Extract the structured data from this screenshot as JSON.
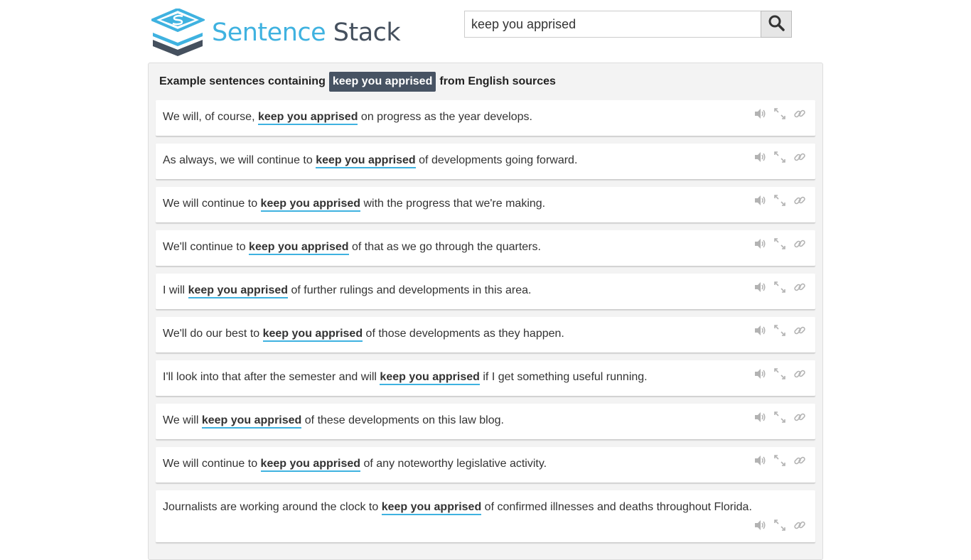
{
  "site": {
    "brand_word_1": "Sentence",
    "brand_word_2": "Stack"
  },
  "search": {
    "value": "keep you apprised",
    "placeholder": ""
  },
  "header": {
    "prefix": "Example sentences containing",
    "term": "keep you apprised",
    "suffix": "from English sources"
  },
  "icons": [
    "speaker-icon",
    "expand-icon",
    "link-icon",
    "search-icon"
  ],
  "colors": {
    "accent": "#3fb2e0",
    "dark": "#475363",
    "panel_bg": "#f3f3f3"
  },
  "sentences": [
    {
      "before": "We will, of course, ",
      "phrase": "keep you apprised",
      "after": " on progress as the year develops."
    },
    {
      "before": "As always, we will continue to ",
      "phrase": "keep you apprised",
      "after": " of developments going forward."
    },
    {
      "before": "We will continue to ",
      "phrase": "keep you apprised",
      "after": " with the progress that we're making."
    },
    {
      "before": "We'll continue to ",
      "phrase": "keep you apprised",
      "after": " of that as we go through the quarters."
    },
    {
      "before": "I will ",
      "phrase": "keep you apprised",
      "after": " of further rulings and developments in this area."
    },
    {
      "before": "We'll do our best to ",
      "phrase": "keep you apprised",
      "after": " of those developments as they happen."
    },
    {
      "before": "I'll look into that after the semester and will ",
      "phrase": "keep you apprised",
      "after": " if I get something useful running."
    },
    {
      "before": "We will ",
      "phrase": "keep you apprised",
      "after": " of these developments on this law blog."
    },
    {
      "before": "We will continue to ",
      "phrase": "keep you apprised",
      "after": " of any noteworthy legislative activity."
    },
    {
      "before": "Journalists are working around the clock to ",
      "phrase": "keep you apprised",
      "after": " of confirmed illnesses and deaths throughout Florida."
    }
  ]
}
